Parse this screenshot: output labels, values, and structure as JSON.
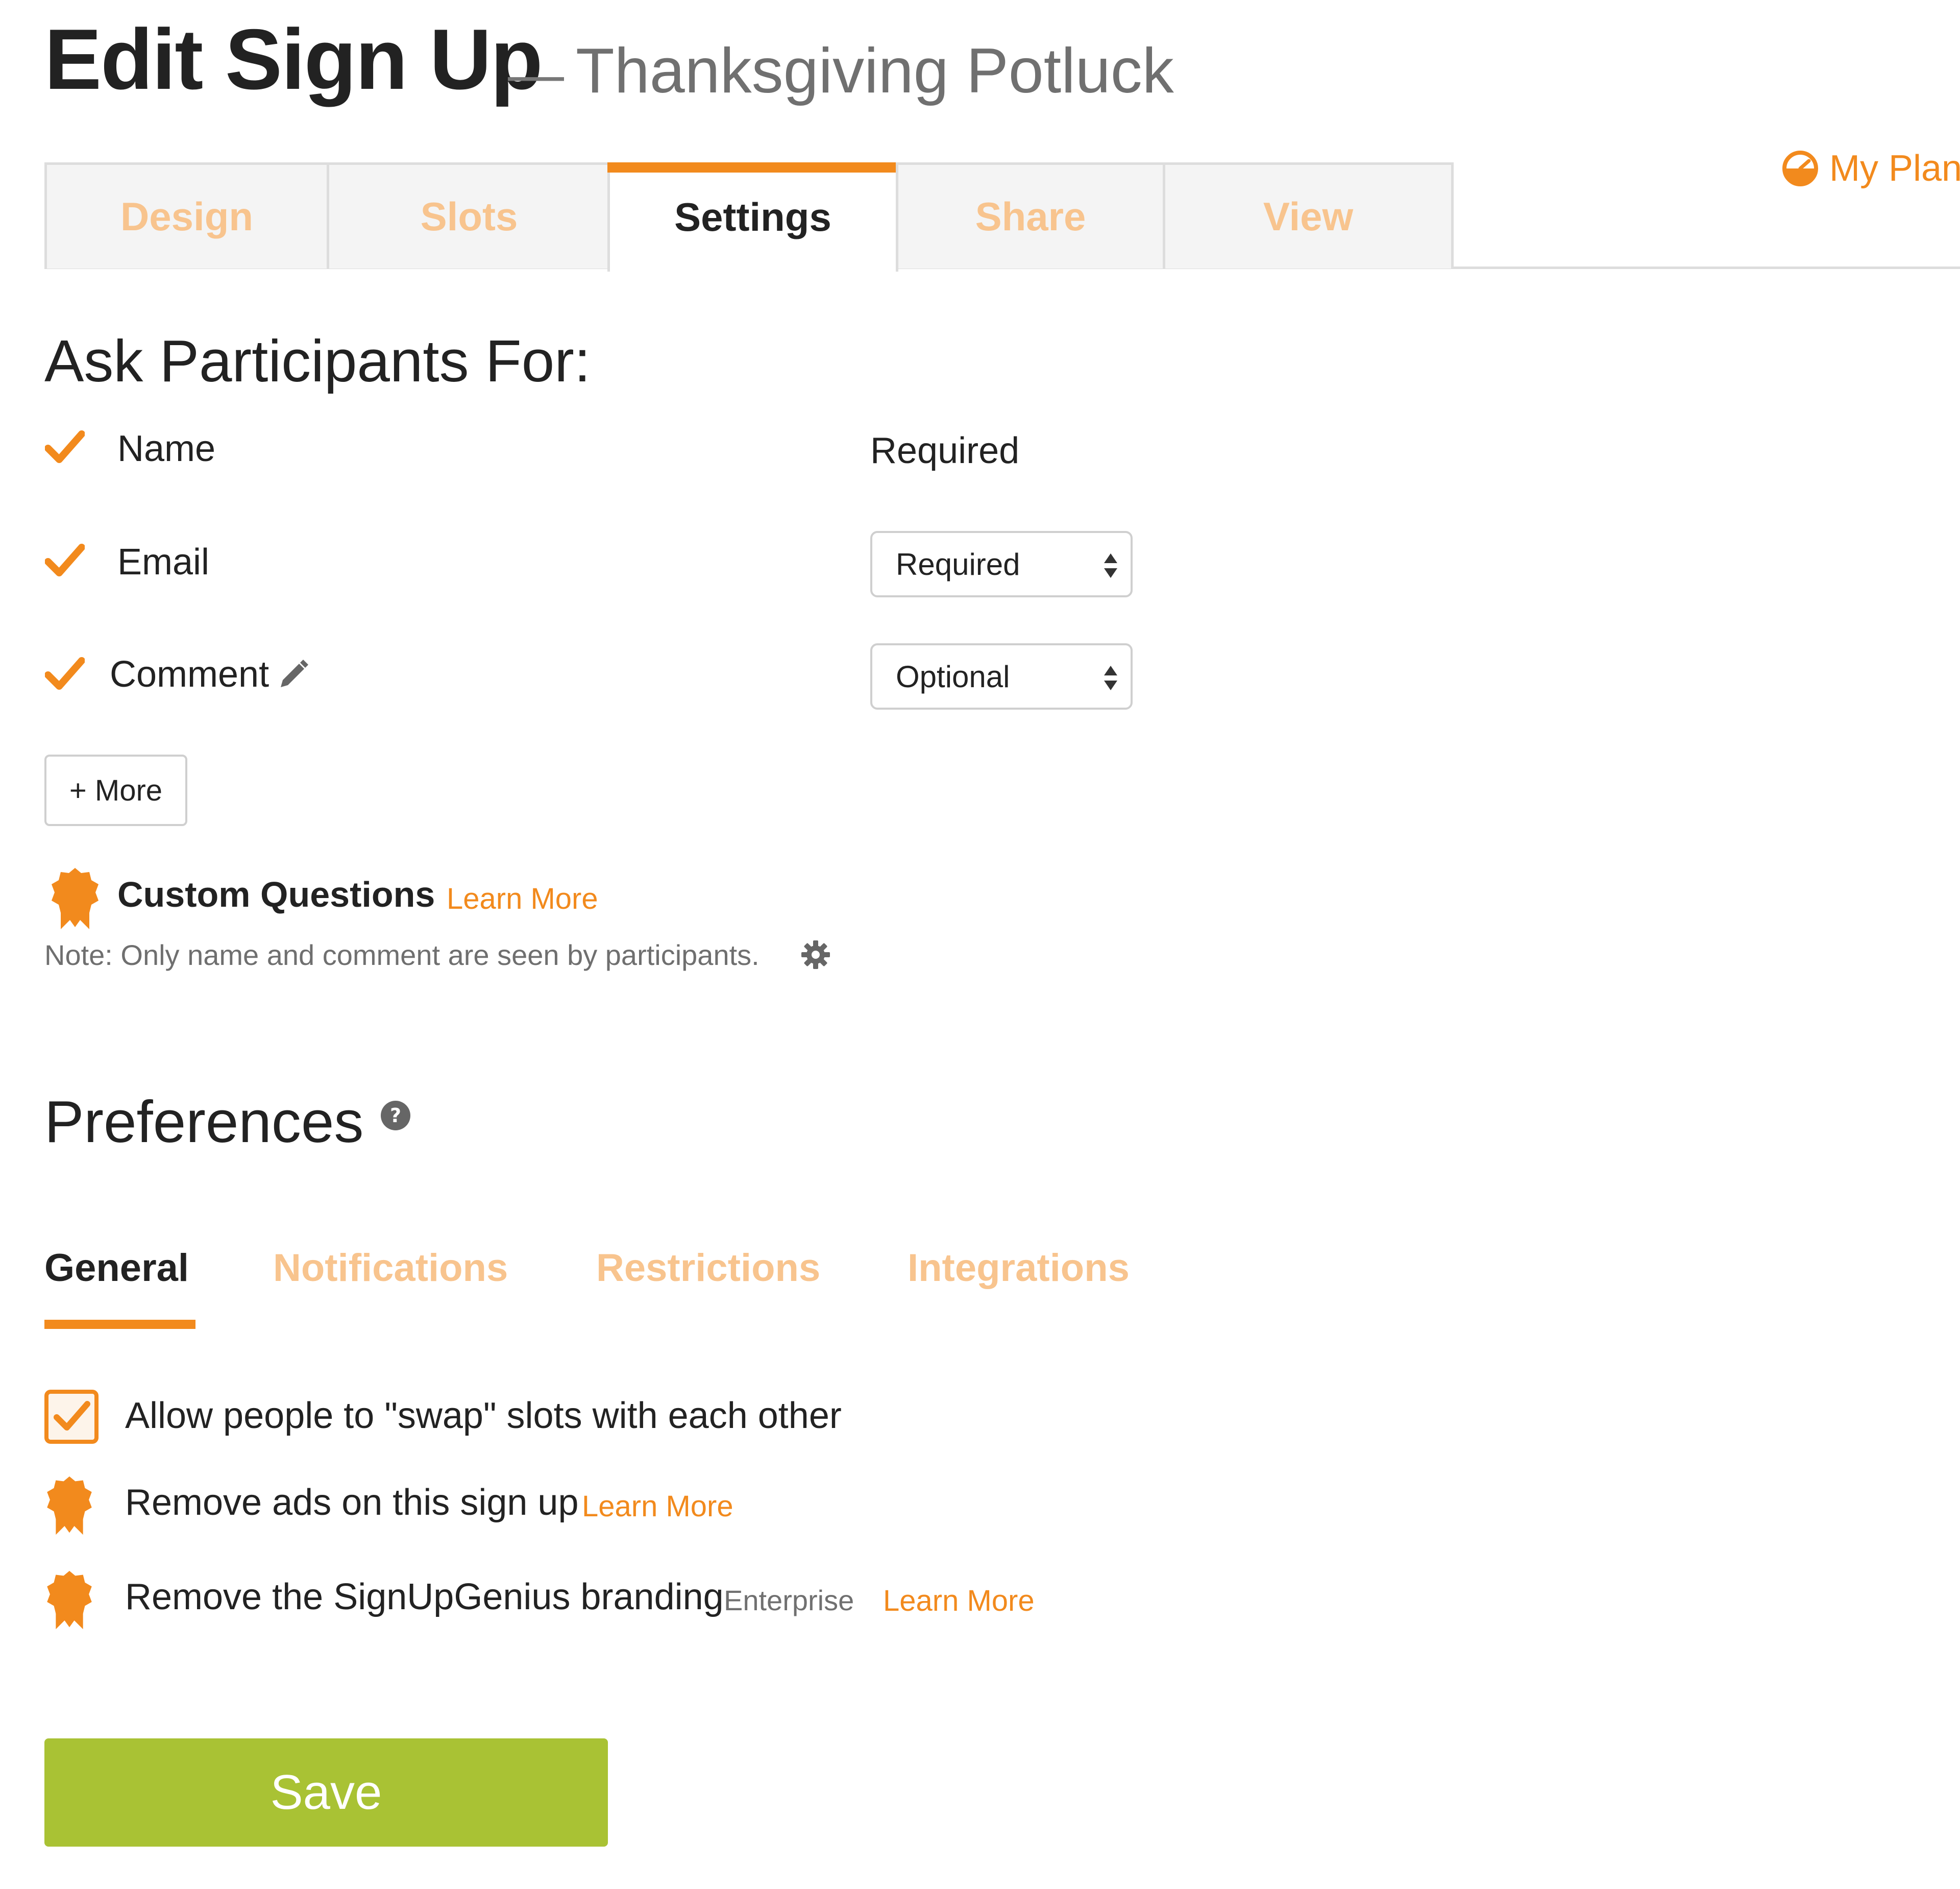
{
  "header": {
    "title": "Edit Sign Up",
    "dash": "—",
    "event_name": "Thanksgiving Potluck",
    "my_plan_label": "My Plan"
  },
  "main_tabs": [
    {
      "label": "Design",
      "active": false
    },
    {
      "label": "Slots",
      "active": false
    },
    {
      "label": "Settings",
      "active": true
    },
    {
      "label": "Share",
      "active": false
    },
    {
      "label": "View",
      "active": false
    }
  ],
  "ask_participants": {
    "heading": "Ask Participants For:",
    "fields": [
      {
        "label": "Name",
        "checked": true,
        "requirement": "Required"
      },
      {
        "label": "Email",
        "checked": true,
        "requirement": "Required"
      },
      {
        "label": "Comment",
        "checked": true,
        "requirement": "Optional"
      }
    ],
    "more_button": "+ More",
    "custom_questions_label": "Custom Questions",
    "custom_questions_link": "Learn More",
    "note": "Note: Only name and comment are seen by participants."
  },
  "preferences": {
    "heading": "Preferences",
    "tabs": [
      {
        "label": "General",
        "active": true
      },
      {
        "label": "Notifications",
        "active": false
      },
      {
        "label": "Restrictions",
        "active": false
      },
      {
        "label": "Integrations",
        "active": false
      }
    ],
    "items": [
      {
        "label": "Allow people to \"swap\" slots with each other",
        "checked": true
      },
      {
        "label": "Remove ads on this sign up",
        "link": "Learn More"
      },
      {
        "label": "Remove the SignUpGenius branding",
        "tag": "Enterprise",
        "link": "Learn More"
      }
    ]
  },
  "save_button": "Save",
  "colors": {
    "accent": "#f28a1d",
    "accent_light": "#f8c48e",
    "save_green": "#a9c234"
  }
}
